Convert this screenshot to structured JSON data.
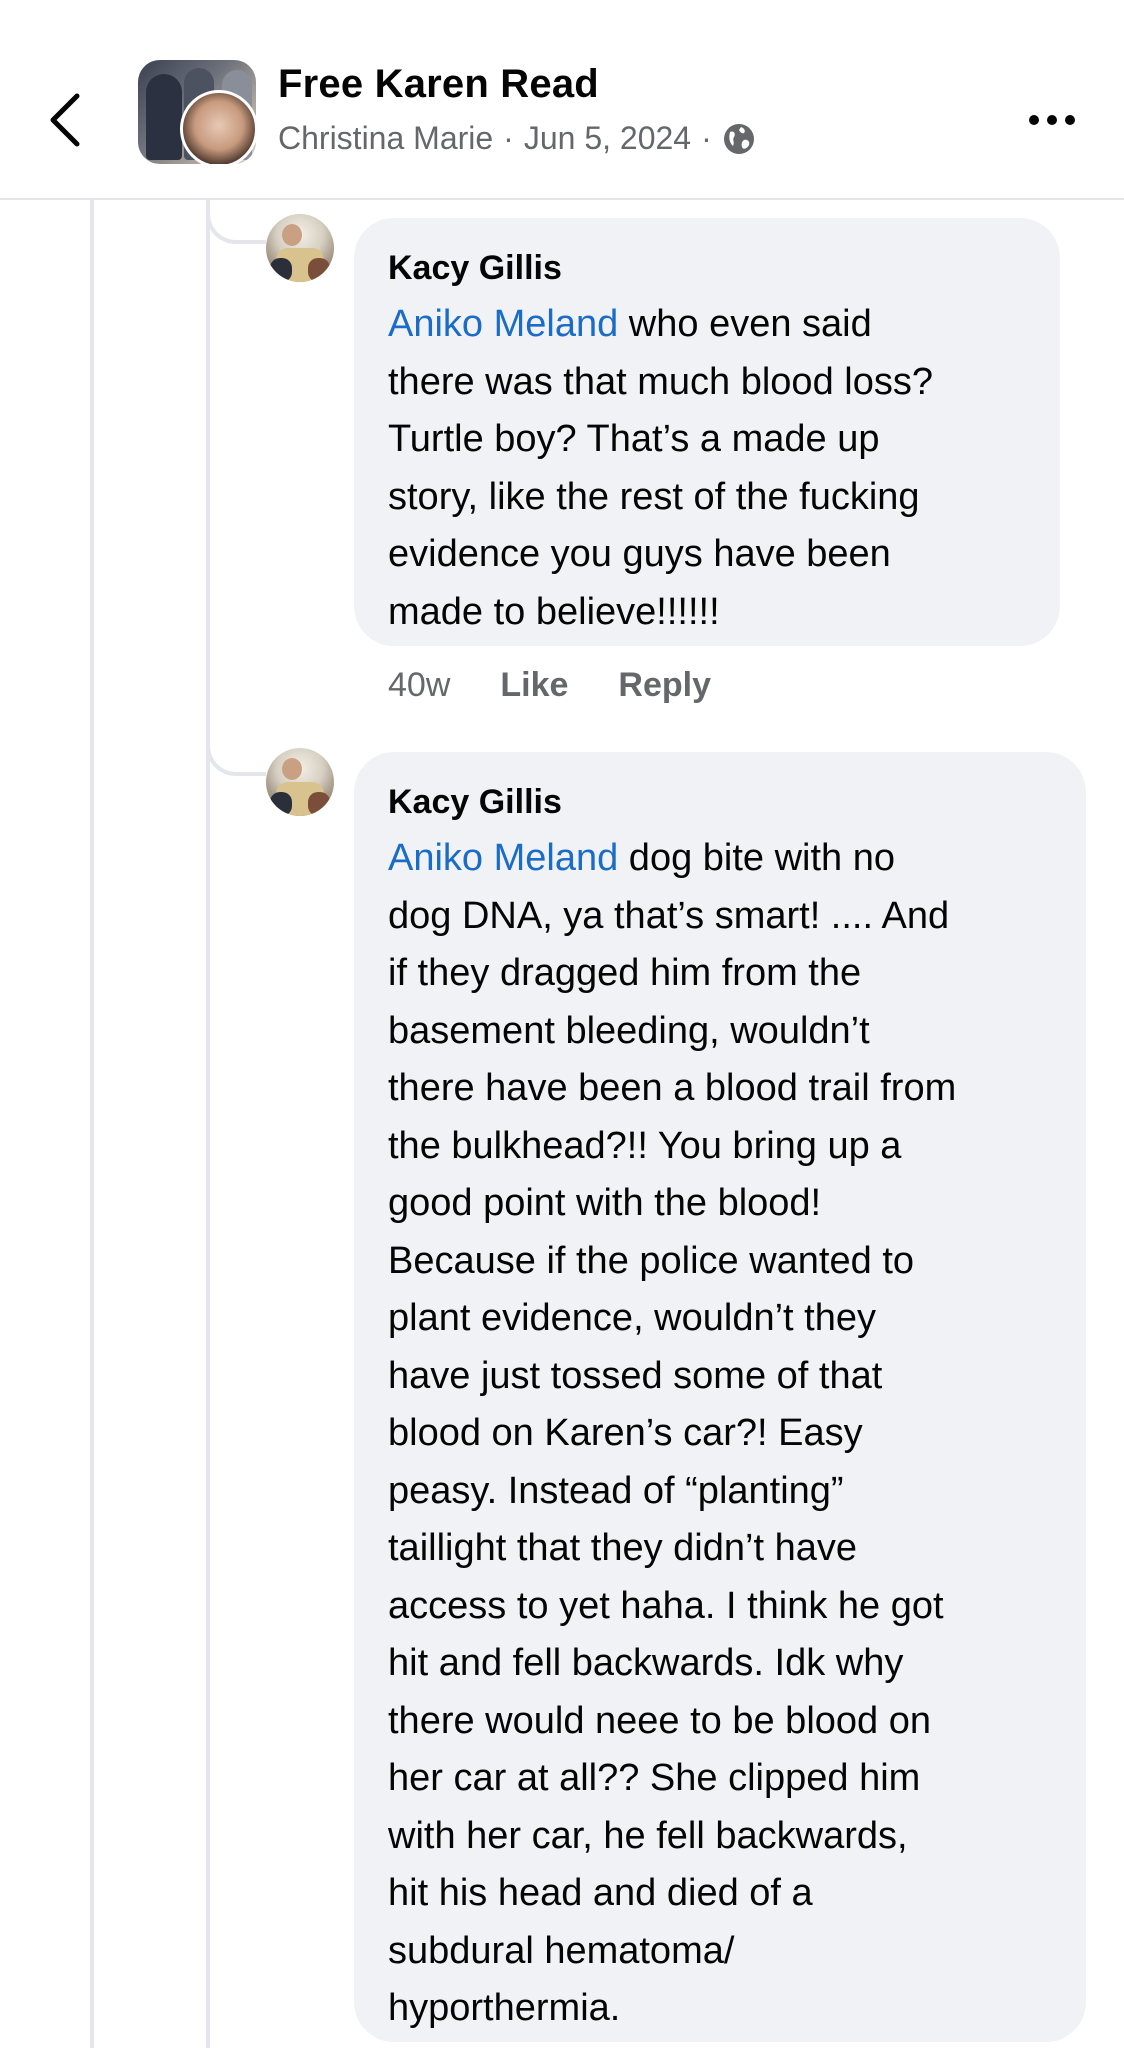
{
  "header": {
    "group_name": "Free Karen Read",
    "poster": "Christina Marie",
    "separator": "·",
    "date": "Jun 5, 2024",
    "separator2": "·",
    "privacy_icon": "globe-icon",
    "back_icon": "chevron-left-icon",
    "more_icon": "more-horizontal-icon"
  },
  "comments": [
    {
      "author": "Kacy Gillis",
      "mention": "Aniko Meland",
      "text_lines": [
        " who even said",
        "there was that much blood loss?",
        "Turtle boy? That’s a made up",
        "story, like the rest of the fucking",
        "evidence you guys have been",
        "made to believe!!!!!!"
      ],
      "time": "40w",
      "like_label": "Like",
      "reply_label": "Reply"
    },
    {
      "author": "Kacy Gillis",
      "mention": "Aniko Meland",
      "text_lines": [
        " dog bite with no",
        "dog DNA, ya that’s smart! .... And",
        "if they dragged him from the",
        "basement bleeding, wouldn’t",
        "there have been a blood trail from",
        "the bulkhead?!! You bring up a",
        "good point with the blood!",
        "Because if the police wanted to",
        "plant evidence, wouldn’t they",
        "have just tossed some of that",
        "blood on Karen’s car?! Easy",
        "peasy. Instead of “planting”",
        "taillight that they didn’t have",
        "access to yet haha. I think he got",
        "hit and fell backwards. Idk why",
        "there would neee to be blood on",
        "her car at all?? She clipped him",
        "with her car, he fell backwards,",
        "hit his head and died of a",
        "subdural hematoma/",
        "hyporthermia."
      ]
    }
  ],
  "colors": {
    "mention": "#1a6cc7",
    "bubble": "#f0f2f5",
    "meta": "#65676b",
    "text": "#050505"
  }
}
